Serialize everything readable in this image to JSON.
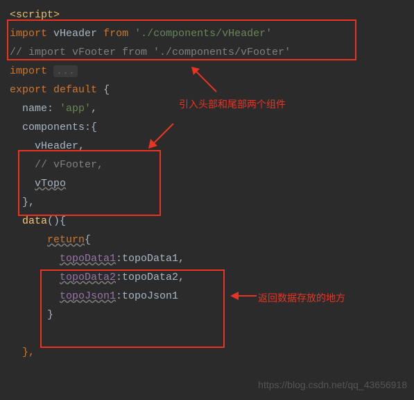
{
  "code": {
    "scriptOpen": "<script>",
    "importHeader": {
      "kw": "import",
      "name": "vHeader",
      "from": "from",
      "path": "'./components/vHeader'"
    },
    "importFooterComment": "// import vFooter from './components/vFooter'",
    "importFold": {
      "kw": "import",
      "dots": "..."
    },
    "exportDefault": {
      "kw1": "export",
      "kw2": "default",
      "brace": "{"
    },
    "nameLine": {
      "key": "name",
      "val": "'app'",
      "comma": ","
    },
    "componentsKey": {
      "key": "components",
      "open": ":{"
    },
    "compItems": {
      "vHeader": "vHeader",
      "vFooterComment": "// vFooter,",
      "vTopo": "vTopo"
    },
    "closeBrace1": "},",
    "dataLine": {
      "fn": "data",
      "rest": "(){"
    },
    "returnLine": {
      "kw": "return",
      "brace": "{"
    },
    "dataItems": {
      "l1k": "topoData1",
      "l1v": ":topoData1,",
      "l2k": "topoData2",
      "l2v": ":topoData2,",
      "l3k": "topoJson1",
      "l3v": ":topoJson1"
    },
    "closeBraceInner": "}",
    "closeBrace2": "},"
  },
  "annotations": {
    "ann1": "引入头部和尾部两个组件",
    "ann2": "返回数据存放的地方"
  },
  "watermark": "https://blog.csdn.net/qq_43656918"
}
